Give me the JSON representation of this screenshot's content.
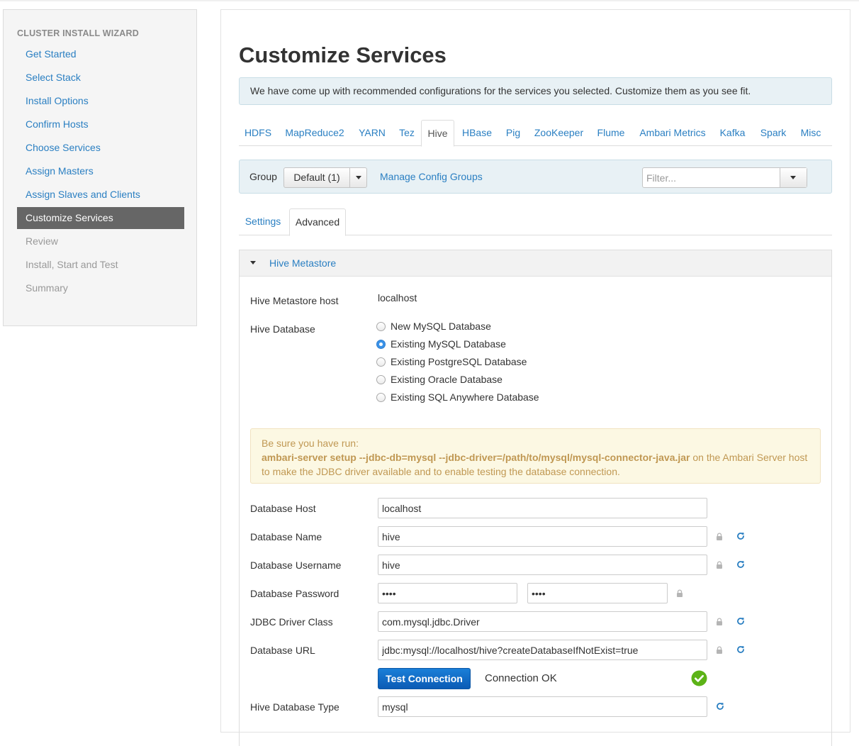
{
  "sidebar": {
    "heading": "CLUSTER INSTALL WIZARD",
    "items": [
      {
        "label": "Get Started",
        "state": "link"
      },
      {
        "label": "Select Stack",
        "state": "link"
      },
      {
        "label": "Install Options",
        "state": "link"
      },
      {
        "label": "Confirm Hosts",
        "state": "link"
      },
      {
        "label": "Choose Services",
        "state": "link"
      },
      {
        "label": "Assign Masters",
        "state": "link"
      },
      {
        "label": "Assign Slaves and Clients",
        "state": "link"
      },
      {
        "label": "Customize Services",
        "state": "active"
      },
      {
        "label": "Review",
        "state": "disabled"
      },
      {
        "label": "Install, Start and Test",
        "state": "disabled"
      },
      {
        "label": "Summary",
        "state": "disabled"
      }
    ]
  },
  "main": {
    "title": "Customize Services",
    "info": "We have come up with recommended configurations for the services you selected. Customize them as you see fit."
  },
  "service_tabs": [
    "HDFS",
    "MapReduce2",
    "YARN",
    "Tez",
    "Hive",
    "HBase",
    "Pig",
    "ZooKeeper",
    "Flume",
    "Ambari Metrics",
    "Kafka",
    "Spark",
    "Misc"
  ],
  "active_service_tab": "Hive",
  "group_bar": {
    "label": "Group",
    "selected": "Default (1)",
    "manage_link": "Manage Config Groups",
    "filter_placeholder": "Filter..."
  },
  "sub_tabs": [
    "Settings",
    "Advanced"
  ],
  "active_sub_tab": "Advanced",
  "section": {
    "title": "Hive Metastore",
    "metastore_host_label": "Hive Metastore host",
    "metastore_host_value": "localhost",
    "database_label": "Hive Database",
    "database_options": [
      {
        "label": "New MySQL Database",
        "checked": false
      },
      {
        "label": "Existing MySQL Database",
        "checked": true
      },
      {
        "label": "Existing PostgreSQL Database",
        "checked": false
      },
      {
        "label": "Existing Oracle Database",
        "checked": false
      },
      {
        "label": "Existing SQL Anywhere Database",
        "checked": false
      }
    ],
    "warning": {
      "line1": "Be sure you have run:",
      "command": "ambari-server setup --jdbc-db=mysql --jdbc-driver=/path/to/mysql/mysql-connector-java.jar",
      "suffix": " on the Ambari Server host to make the JDBC driver available and to enable testing the database connection."
    },
    "fields": {
      "db_host": {
        "label": "Database Host",
        "value": "localhost"
      },
      "db_name": {
        "label": "Database Name",
        "value": "hive"
      },
      "db_username": {
        "label": "Database Username",
        "value": "hive"
      },
      "db_password": {
        "label": "Database Password",
        "value": "••••",
        "confirm_value": "••••"
      },
      "jdbc_driver": {
        "label": "JDBC Driver Class",
        "value": "com.mysql.jdbc.Driver"
      },
      "db_url": {
        "label": "Database URL",
        "value": "jdbc:mysql://localhost/hive?createDatabaseIfNotExist=true"
      },
      "db_type": {
        "label": "Hive Database Type",
        "value": "mysql"
      }
    },
    "test_button": "Test Connection",
    "connection_status": "Connection OK"
  },
  "colors": {
    "link": "#2a7fc2",
    "active_nav": "#666666",
    "success": "#5cb317",
    "warning_text": "#c09853"
  }
}
